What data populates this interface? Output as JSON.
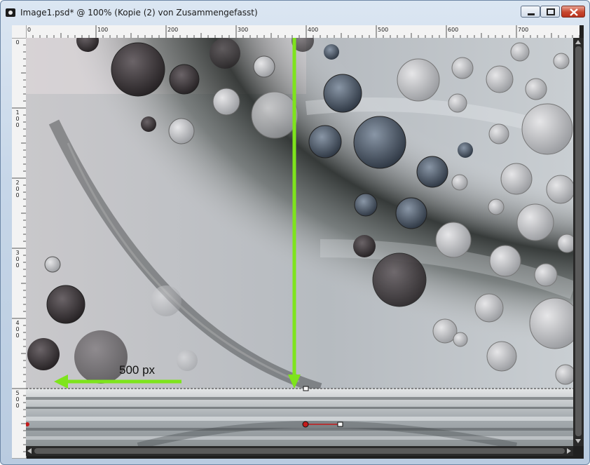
{
  "window": {
    "title": "Image1.psd* @ 100% (Kopie (2) von Zusammengefasst)",
    "controls": {
      "minimize": "minimize",
      "maximize": "maximize",
      "close": "close"
    }
  },
  "ruler": {
    "horizontal_labels": [
      "0",
      "100",
      "200",
      "300",
      "400",
      "500",
      "600",
      "700"
    ],
    "vertical_labels": [
      "0",
      "100",
      "200",
      "300",
      "400",
      "500"
    ]
  },
  "canvas": {
    "annotation": "500 px"
  },
  "colors": {
    "annotation_arrow": "#7ee41c",
    "close_button": "#c7472f",
    "window_frame": "#c6d6e8",
    "workspace": "#202020"
  },
  "icons": {
    "app": "app-icon",
    "minimize": "minimize-icon",
    "maximize": "maximize-icon",
    "close": "close-icon"
  }
}
